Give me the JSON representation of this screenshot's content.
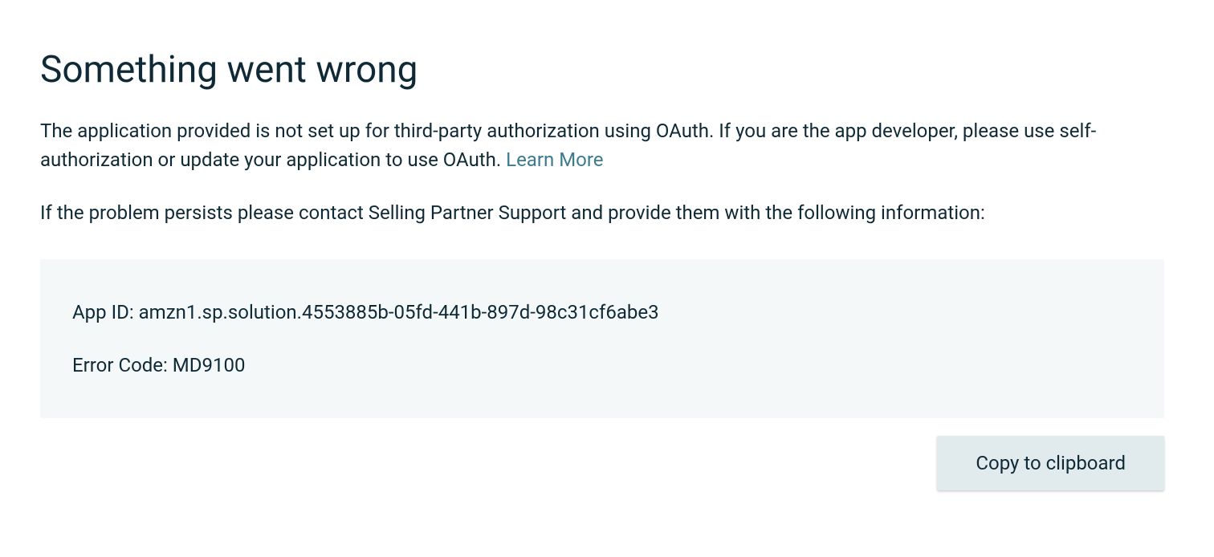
{
  "heading": "Something went wrong",
  "description_text": "The application provided is not set up for third-party authorization using OAuth. If you are the app developer, please use self-authorization or update your application to use OAuth. ",
  "learn_more": "Learn More",
  "persist_text": "If the problem persists please contact Selling Partner Support and provide them with the following information:",
  "info": {
    "app_id_line": "App ID: amzn1.sp.solution.4553885b-05fd-441b-897d-98c31cf6abe3",
    "error_code_line": "Error Code: MD9100"
  },
  "copy_button": "Copy to clipboard"
}
